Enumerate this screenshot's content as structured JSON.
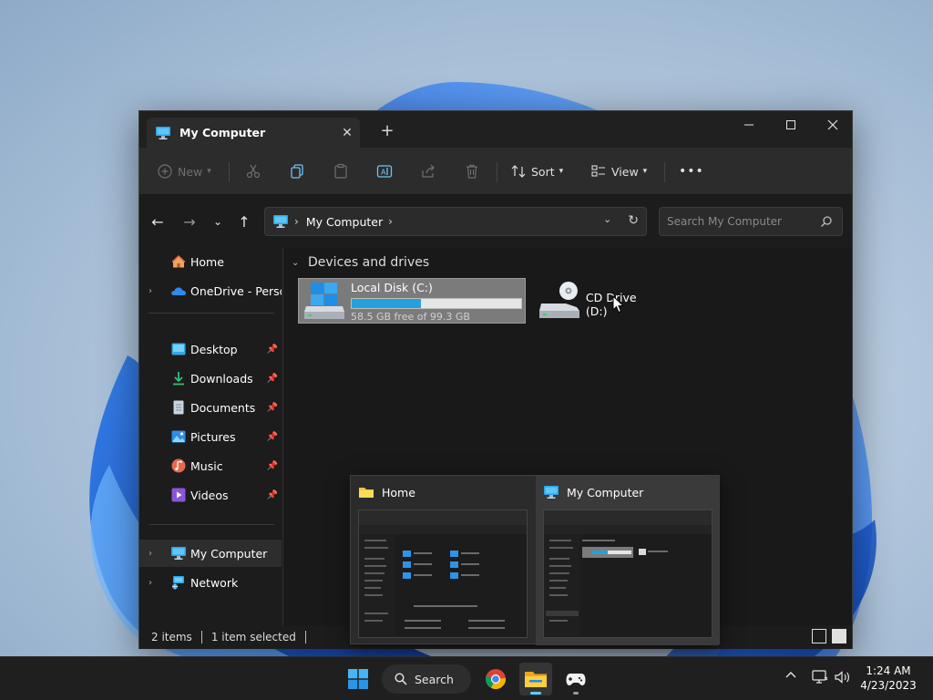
{
  "window": {
    "tab_title": "My Computer",
    "new_tab_label": "+",
    "controls": {
      "minimize": "minimize",
      "maximize": "maximize",
      "close": "close"
    }
  },
  "toolbar": {
    "new_label": "New",
    "sort_label": "Sort",
    "view_label": "View",
    "more_label": "•••"
  },
  "address": {
    "location": "My Computer",
    "search_placeholder": "Search My Computer"
  },
  "sidebar": {
    "items": [
      {
        "label": "Home",
        "icon": "home-icon"
      },
      {
        "label": "OneDrive - Persona",
        "icon": "onedrive-icon"
      },
      {
        "label": "Desktop",
        "icon": "desktop-icon"
      },
      {
        "label": "Downloads",
        "icon": "downloads-icon"
      },
      {
        "label": "Documents",
        "icon": "documents-icon"
      },
      {
        "label": "Pictures",
        "icon": "pictures-icon"
      },
      {
        "label": "Music",
        "icon": "music-icon"
      },
      {
        "label": "Videos",
        "icon": "videos-icon"
      },
      {
        "label": "My Computer",
        "icon": "computer-icon"
      },
      {
        "label": "Network",
        "icon": "network-icon"
      }
    ]
  },
  "content": {
    "group_title": "Devices and drives",
    "drives": [
      {
        "name": "Local Disk (C:)",
        "free_text": "58.5 GB free of 99.3 GB",
        "used_fraction": 0.41
      },
      {
        "name": "CD Drive (D:)"
      }
    ]
  },
  "status": {
    "item_count": "2 items",
    "selection": "1 item selected"
  },
  "preview": {
    "cards": [
      {
        "title": "Home"
      },
      {
        "title": "My Computer"
      }
    ]
  },
  "taskbar": {
    "search_label": "Search",
    "time": "1:24 AM",
    "date": "4/23/2023"
  },
  "colors": {
    "accent": "#26a0da",
    "taskbar_indicator": "#60cdff",
    "window_bg": "#1c1c1c",
    "selection_bg": "#7b7b7b"
  }
}
